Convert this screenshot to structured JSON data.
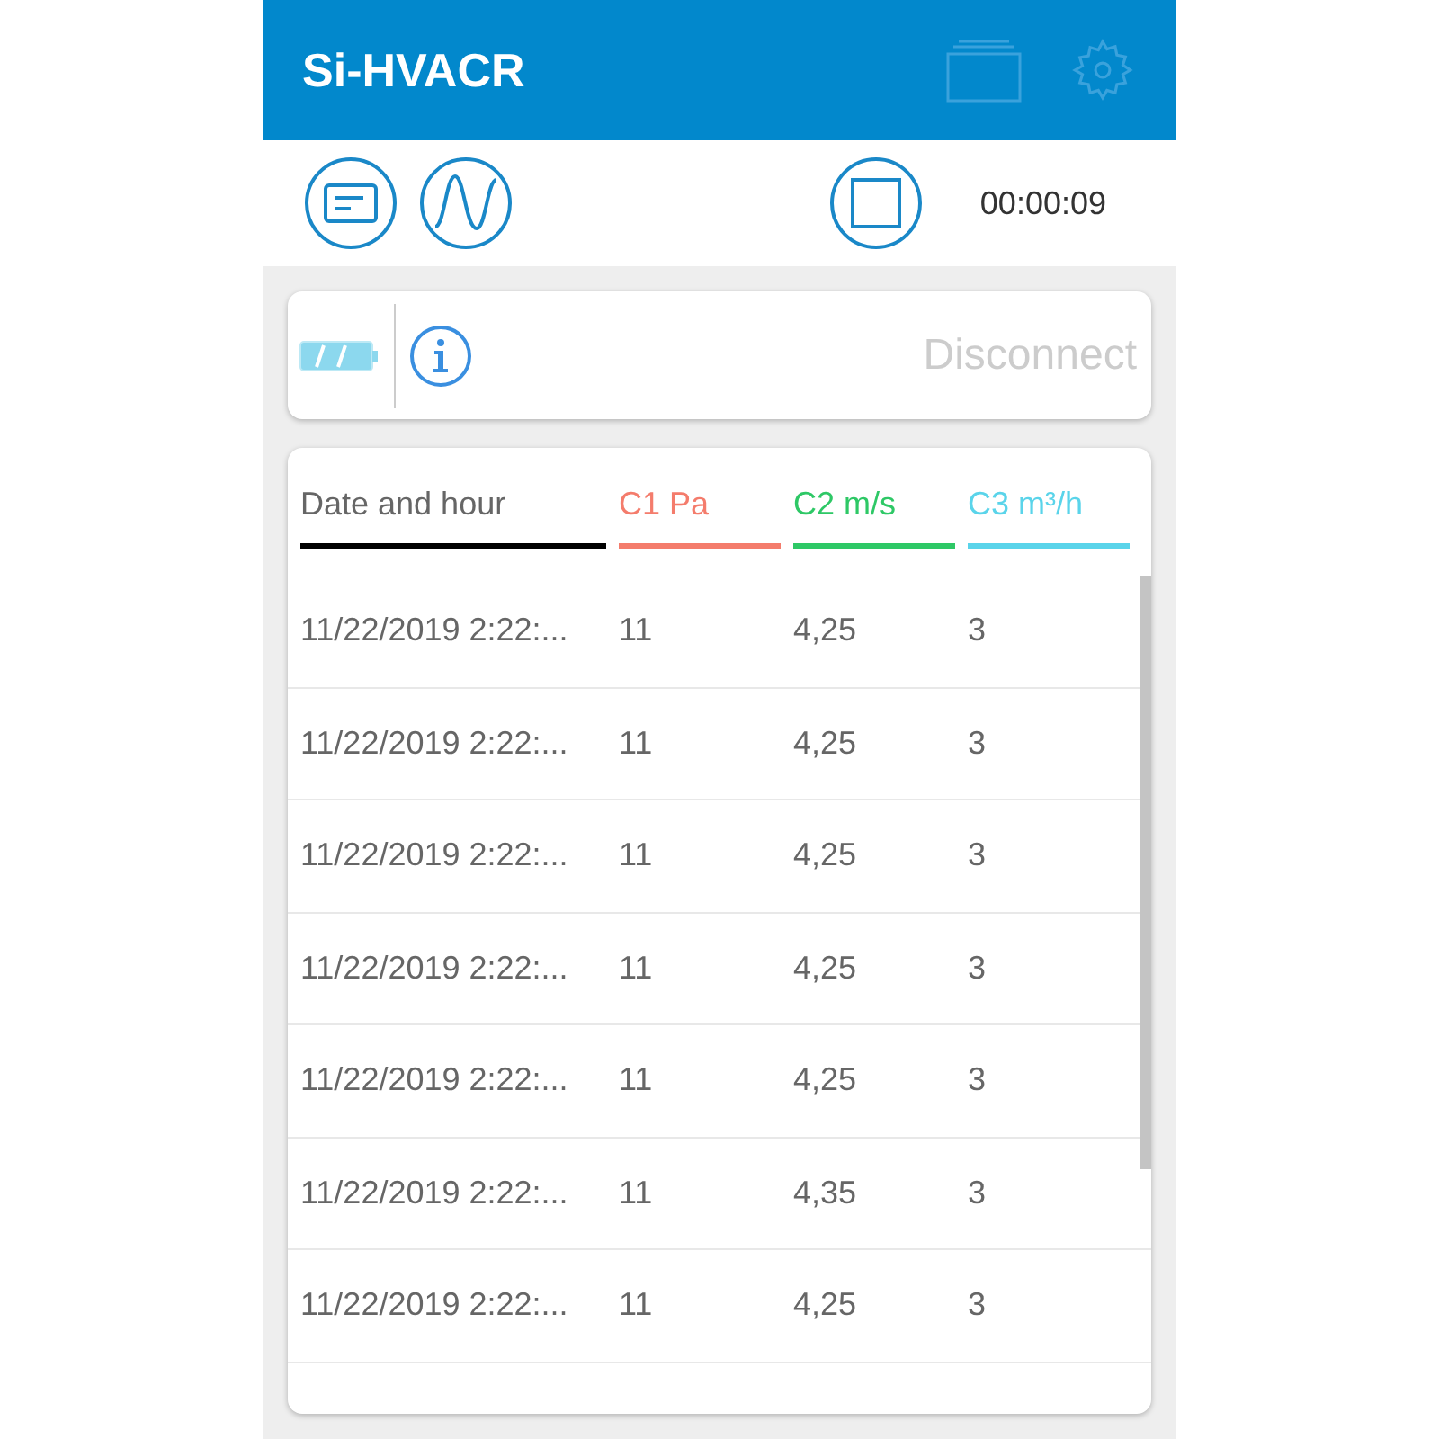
{
  "app_bar": {
    "title": "Si-HVACR"
  },
  "toolbar": {
    "timer": "00:00:09"
  },
  "status_card": {
    "disconnect": {
      "label": "Disconnect",
      "disabled": true
    }
  },
  "table": {
    "columns": [
      {
        "label": "Date and hour",
        "color": "#000000"
      },
      {
        "label": "C1 Pa",
        "color": "#f47c6c"
      },
      {
        "label": "C2 m/s",
        "color": "#2ec866"
      },
      {
        "label": "C3 m³/h",
        "color": "#5ad4ea"
      }
    ],
    "rows": [
      [
        "11/22/2019 2:22:...",
        "11",
        "4,25",
        "3"
      ],
      [
        "11/22/2019 2:22:...",
        "11",
        "4,25",
        "3"
      ],
      [
        "11/22/2019 2:22:...",
        "11",
        "4,25",
        "3"
      ],
      [
        "11/22/2019 2:22:...",
        "11",
        "4,25",
        "3"
      ],
      [
        "11/22/2019 2:22:...",
        "11",
        "4,25",
        "3"
      ],
      [
        "11/22/2019 2:22:...",
        "11",
        "4,35",
        "3"
      ],
      [
        "11/22/2019 2:22:...",
        "11",
        "4,25",
        "3"
      ]
    ]
  }
}
